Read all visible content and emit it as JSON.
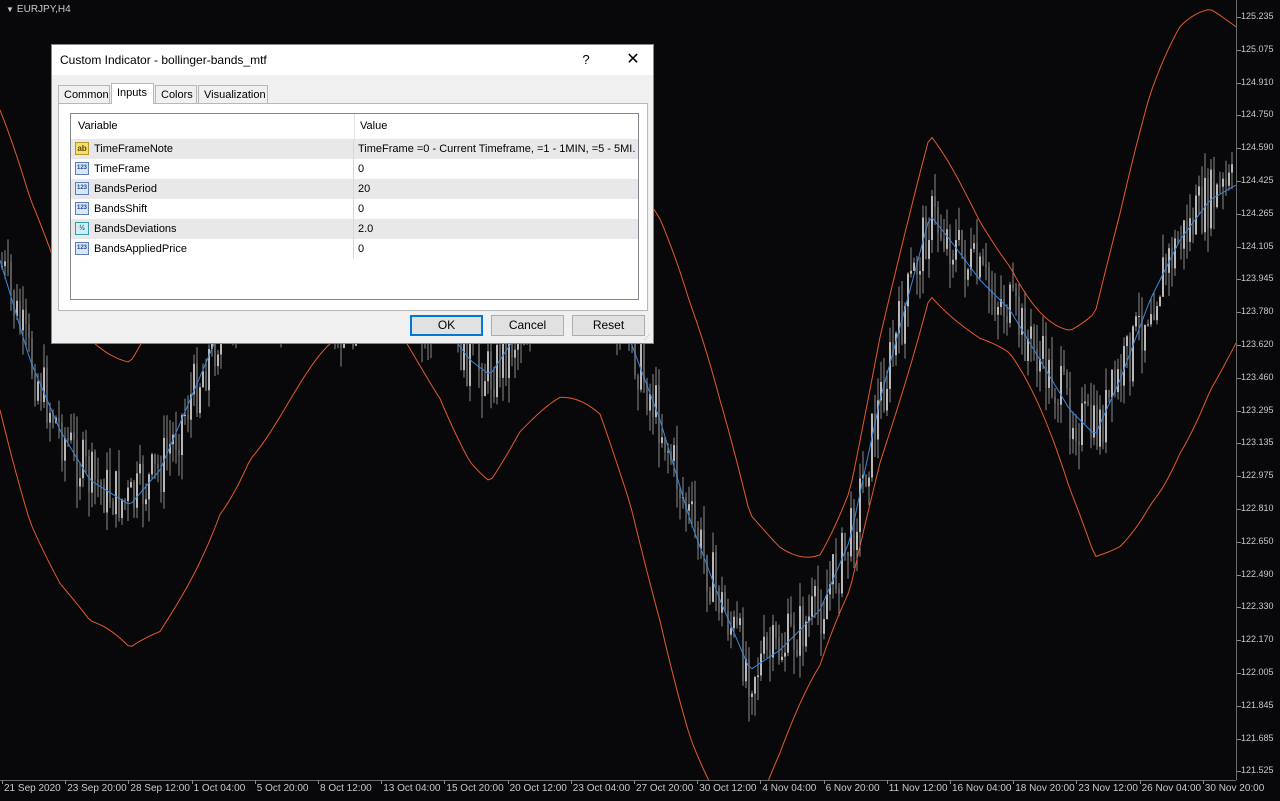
{
  "chart": {
    "symbol": "EURJPY,H4",
    "price_labels": [
      "125.235",
      "125.075",
      "124.910",
      "124.750",
      "124.590",
      "124.425",
      "124.265",
      "124.105",
      "123.945",
      "123.780",
      "123.620",
      "123.460",
      "123.295",
      "123.135",
      "122.975",
      "122.810",
      "122.650",
      "122.490",
      "122.330",
      "122.170",
      "122.005",
      "121.845",
      "121.685",
      "121.525"
    ],
    "time_labels": [
      "21 Sep 2020",
      "23 Sep 20:00",
      "28 Sep 12:00",
      "1 Oct 04:00",
      "5 Oct 20:00",
      "8 Oct 12:00",
      "13 Oct 04:00",
      "15 Oct 20:00",
      "20 Oct 12:00",
      "23 Oct 04:00",
      "27 Oct 20:00",
      "30 Oct 12:00",
      "4 Nov 04:00",
      "6 Nov 20:00",
      "11 Nov 12:00",
      "16 Nov 04:00",
      "18 Nov 20:00",
      "23 Nov 12:00",
      "26 Nov 04:00",
      "30 Nov 20:00"
    ],
    "colors": {
      "background": "#08080a",
      "candles": "#8a8a8a",
      "middle_band": "#3b87d6",
      "outer_bands": "#e25a2e"
    }
  },
  "dialog": {
    "title": "Custom Indicator - bollinger-bands_mtf",
    "help_label": "?",
    "close_label": "✕",
    "tabs": [
      {
        "label": "Common"
      },
      {
        "label": "Inputs"
      },
      {
        "label": "Colors"
      },
      {
        "label": "Visualization"
      }
    ],
    "active_tab": "Inputs",
    "grid_headers": {
      "variable": "Variable",
      "value": "Value"
    },
    "rows": [
      {
        "name": "TimeFrameNote",
        "value": "TimeFrame =0 - Current Timeframe, =1 - 1MIN, =5 - 5MI...",
        "icon": "string-type-icon",
        "icon_text": "ab"
      },
      {
        "name": "TimeFrame",
        "value": "0",
        "icon": "integer-type-icon",
        "icon_text": "123"
      },
      {
        "name": "BandsPeriod",
        "value": "20",
        "icon": "integer-type-icon",
        "icon_text": "123"
      },
      {
        "name": "BandsShift",
        "value": "0",
        "icon": "integer-type-icon",
        "icon_text": "123"
      },
      {
        "name": "BandsDeviations",
        "value": "2.0",
        "icon": "double-type-icon",
        "icon_text": "½"
      },
      {
        "name": "BandsAppliedPrice",
        "value": "0",
        "icon": "integer-type-icon",
        "icon_text": "123"
      }
    ],
    "buttons": {
      "ok": "OK",
      "cancel": "Cancel",
      "reset": "Reset"
    }
  }
}
